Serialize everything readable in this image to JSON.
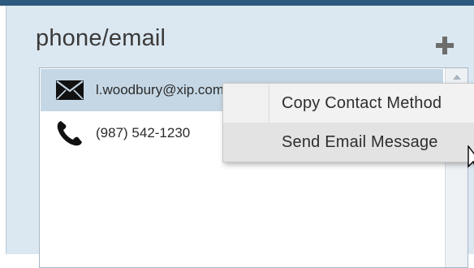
{
  "panel": {
    "title": "phone/email",
    "add_icon": "plus-icon"
  },
  "contacts": [
    {
      "icon": "envelope-icon",
      "value": "l.woodbury@xip.com",
      "selected": true
    },
    {
      "icon": "phone-icon",
      "value": "(987) 542-1230",
      "selected": false
    }
  ],
  "context_menu": {
    "items": [
      {
        "label": "Copy Contact Method"
      },
      {
        "label": "Send Email Message"
      }
    ]
  },
  "colors": {
    "top_bar": "#2d5a7f",
    "panel_bg": "#dce8f1",
    "selected_row": "#c5d7e5",
    "menu_bg": "#f2f2f2"
  }
}
